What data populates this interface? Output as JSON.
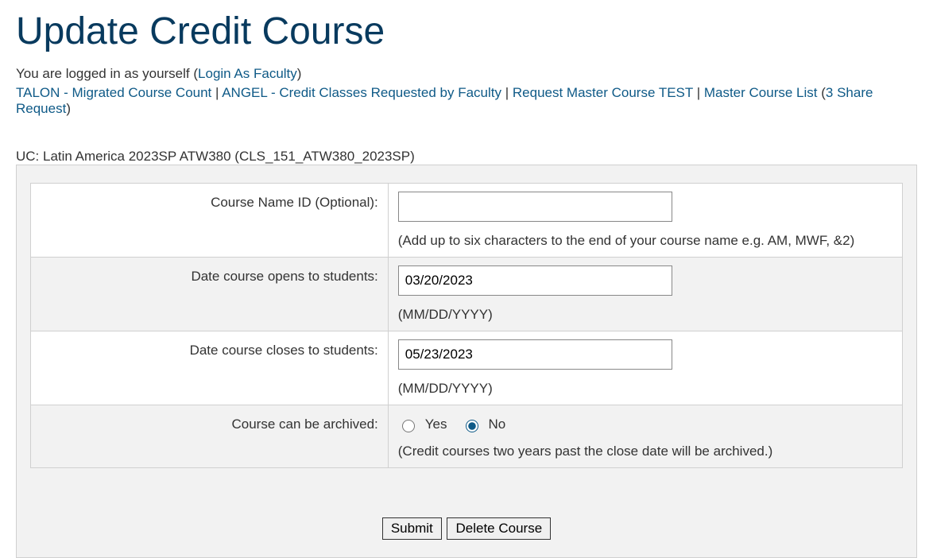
{
  "page_title": "Update Credit Course",
  "login_info": {
    "prefix": "You are logged in as yourself (",
    "login_as_link": "Login As Faculty",
    "suffix": ")"
  },
  "nav": {
    "talon": "TALON - Migrated Course Count",
    "sep1": " | ",
    "angel": "ANGEL - Credit Classes Requested by Faculty",
    "sep2": " | ",
    "request_master": "Request Master Course TEST",
    "sep3": " | ",
    "master_list": "Master Course List",
    "share_open": " (",
    "share_count": "3 Share Request",
    "share_close": ")"
  },
  "course_heading": "UC: Latin America 2023SP ATW380 (CLS_151_ATW380_2023SP)",
  "form": {
    "course_name_id": {
      "label": "Course Name ID (Optional):",
      "value": "",
      "hint": "(Add up to six characters to the end of your course name e.g. AM, MWF, &2)"
    },
    "date_open": {
      "label": "Date course opens to students:",
      "value": "03/20/2023",
      "hint": "(MM/DD/YYYY)"
    },
    "date_close": {
      "label": "Date course closes to students:",
      "value": "05/23/2023",
      "hint": "(MM/DD/YYYY)"
    },
    "archive": {
      "label": "Course can be archived:",
      "yes_label": "Yes",
      "no_label": "No",
      "selected": "no",
      "hint": "(Credit courses two years past the close date will be archived.)"
    }
  },
  "buttons": {
    "submit": "Submit",
    "delete": "Delete Course"
  }
}
